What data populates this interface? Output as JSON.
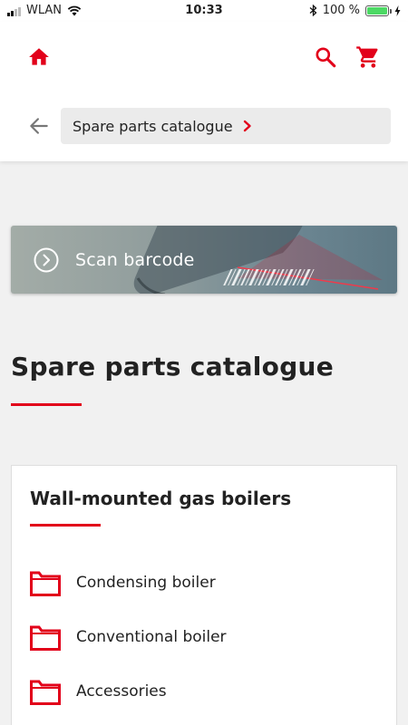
{
  "status_bar": {
    "carrier": "WLAN",
    "time": "10:33",
    "battery_percent": "100 %",
    "icons": [
      "signal-icon",
      "wifi-icon",
      "bluetooth-icon",
      "battery-icon",
      "charging-icon"
    ]
  },
  "header": {
    "icons": [
      "home-icon",
      "search-icon",
      "cart-icon",
      "back-arrow-icon"
    ],
    "breadcrumb_label": "Spare parts catalogue"
  },
  "scan": {
    "label": "Scan barcode",
    "icon": "chevron-circle-icon"
  },
  "page": {
    "title": "Spare parts catalogue"
  },
  "category": {
    "title": "Wall-mounted gas boilers",
    "items": [
      {
        "label": "Condensing boiler",
        "icon": "folder-icon"
      },
      {
        "label": "Conventional boiler",
        "icon": "folder-icon"
      },
      {
        "label": "Accessories",
        "icon": "folder-icon"
      }
    ]
  },
  "colors": {
    "accent": "#e2001a",
    "background": "#f1f1f1",
    "header_bg": "#ffffff",
    "breadcrumb_bg": "#ebebeb"
  }
}
